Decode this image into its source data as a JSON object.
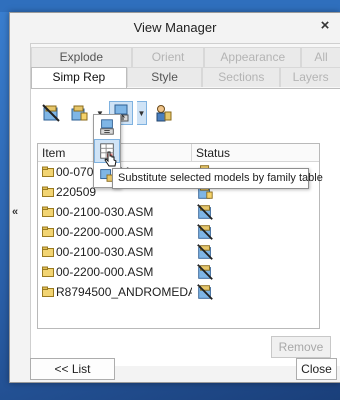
{
  "dialog": {
    "title": "View Manager"
  },
  "tabs_row1": [
    "Explode",
    "Orient",
    "Appearance",
    "All"
  ],
  "tabs_row2": [
    "Simp Rep",
    "Style",
    "Sections",
    "Layers"
  ],
  "list": {
    "headers": {
      "item": "Item",
      "status": "Status"
    },
    "rows": [
      {
        "name": "00-0700",
        "suffix": ".ASM",
        "status_icon": "assembly-status-icon"
      },
      {
        "name": "220509",
        "suffix": "",
        "status_icon": "assembly-status-icon"
      },
      {
        "name": "00-2100-030.ASM",
        "suffix": "",
        "status_icon": "excluded-status-icon"
      },
      {
        "name": "00-2200-000.ASM",
        "suffix": "",
        "status_icon": "excluded-status-icon"
      },
      {
        "name": "00-2100-030.ASM",
        "suffix": "",
        "status_icon": "excluded-status-icon"
      },
      {
        "name": "00-2200-000.ASM",
        "suffix": "",
        "status_icon": "excluded-status-icon"
      },
      {
        "name": "R8794500_ANDROMEDA...",
        "suffix": "",
        "status_icon": "excluded-status-icon"
      }
    ]
  },
  "buttons": {
    "remove": "Remove",
    "list": "<< List",
    "close": "Close",
    "collapse": "«",
    "close_x": "×"
  },
  "tooltip": "Substitute selected models by family table",
  "colors": {
    "accent": "#cfe3f6",
    "accent_border": "#7fb2e0",
    "desktop": "#2a5fa8"
  }
}
